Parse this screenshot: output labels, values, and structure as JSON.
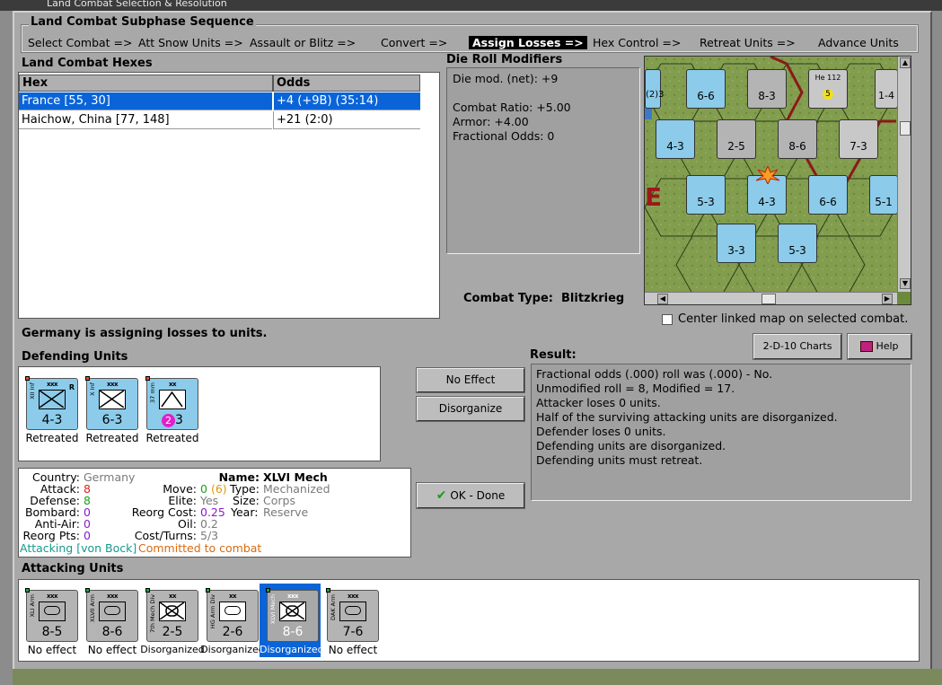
{
  "window": {
    "title": "Land Combat Selection & Resolution"
  },
  "sequence": {
    "title": "Land Combat Subphase Sequence",
    "steps": [
      "Select Combat =>",
      "Att Snow Units =>",
      "Assault or Blitz =>",
      "Convert =>",
      "Assign Losses =>",
      "Hex Control =>",
      "Retreat Units =>",
      "Advance Units"
    ],
    "active": "Assign Losses =>"
  },
  "hexes": {
    "title": "Land Combat Hexes",
    "columns": [
      "Hex",
      "Odds"
    ],
    "rows": [
      {
        "hex": "France [55, 30]",
        "odds": "+4 (+9B) (35:14)"
      },
      {
        "hex": "Haichow, China [77, 148]",
        "odds": "+21 (2:0)"
      }
    ]
  },
  "die_roll": {
    "title": "Die Roll Modifiers",
    "lines": [
      "Die mod. (net): +9",
      "",
      "Combat Ratio: +5.00",
      "Armor: +4.00",
      "Fractional Odds: 0"
    ]
  },
  "combat_type": {
    "label": "Combat Type:",
    "value": "Blitzkrieg"
  },
  "map": {
    "center_linked_label": "Center linked map on selected combat.",
    "unit_labels": [
      "6-6",
      "8-3",
      "He 112",
      "1-4",
      "4-3",
      "2-5",
      "8-6",
      "7-3",
      "5-3",
      "4-3",
      "6-6",
      "5-1",
      "3-3",
      "5-3",
      "(2)3",
      "E",
      "5"
    ]
  },
  "buttons": {
    "charts": "2-D-10 Charts",
    "help": "Help",
    "no_effect": "No Effect",
    "disorganize": "Disorganize",
    "ok_done": "OK - Done"
  },
  "status": "Germany is assigning losses to units.",
  "defending": {
    "title": "Defending Units",
    "units": [
      {
        "side": "XII Inf",
        "size": "xxx",
        "strength": "4-3",
        "status": "Retreated",
        "type": "inf",
        "reserve": "R"
      },
      {
        "side": "X Inf",
        "size": "xxx",
        "strength": "6-3",
        "status": "Retreated",
        "type": "inf",
        "reserve": ""
      },
      {
        "side": "37 mm",
        "size": "xx",
        "strength": "3",
        "badge": "2",
        "status": "Retreated",
        "type": "at",
        "reserve": ""
      }
    ]
  },
  "result": {
    "title": "Result:",
    "lines": [
      "Fractional odds (.000) roll was (.000)  - No.",
      "Unmodified roll = 8, Modified = 17.",
      "Attacker loses 0 units.",
      "Half of the surviving attacking units are disorganized.",
      "Defender loses 0 units.",
      "Defending units are disorganized.",
      "Defending units must retreat."
    ]
  },
  "info": {
    "country_label": "Country:",
    "country": "Germany",
    "name_label": "Name:",
    "name": "XLVI Mech",
    "attack_label": "Attack:",
    "attack": "8",
    "defense_label": "Defense:",
    "defense": "8",
    "bombard_label": "Bombard:",
    "bombard": "0",
    "antiair_label": "Anti-Air:",
    "antiair": "0",
    "reorgpts_label": "Reorg Pts:",
    "reorgpts": "0",
    "move_label": "Move:",
    "move": "0",
    "move_extra": "(6)",
    "type_label": "Type:",
    "type": "Mechanized",
    "elite_label": "Elite:",
    "elite": "Yes",
    "size_label": "Size:",
    "size": "Corps",
    "reorg_cost_label": "Reorg Cost:",
    "reorg_cost": "0.25",
    "year_label": "Year:",
    "year": "Reserve",
    "oil_label": "Oil:",
    "oil": "0.2",
    "cost_label": "Cost/Turns:",
    "cost": "5/3",
    "attacking_note": "Attacking [von Bock]",
    "committed_note": "Committed to combat"
  },
  "attacking": {
    "title": "Attacking Units",
    "units": [
      {
        "side": "XLI Arm",
        "size": "xxx",
        "strength": "8-5",
        "status": "No effect",
        "type": "arm",
        "selected": false
      },
      {
        "side": "XLVII Arm",
        "size": "xxx",
        "strength": "8-6",
        "status": "No effect",
        "type": "arm",
        "selected": false
      },
      {
        "side": "7th Mech Div",
        "size": "xx",
        "strength": "2-5",
        "status": "Disorganized",
        "type": "mech",
        "selected": false
      },
      {
        "side": "HG Arm Div",
        "size": "xx",
        "strength": "2-6",
        "status": "Disorganized",
        "type": "arm",
        "selected": false
      },
      {
        "side": "XLVI Mech",
        "size": "xxx",
        "strength": "8-6",
        "status": "Disorganized",
        "type": "mech",
        "selected": true
      },
      {
        "side": "DAK Arm",
        "size": "xxx",
        "strength": "7-6",
        "status": "No effect",
        "type": "arm",
        "selected": false
      }
    ]
  },
  "colors": {
    "selection": "#0a64d8",
    "attack_red": "#e02020",
    "defense_green": "#18a018",
    "zero_purple": "#8a1ad0",
    "gray_text": "#7a7a7a",
    "attacking_teal": "#169a8a",
    "committed_orange": "#d86a10",
    "unit_blue": "#8ccbea",
    "unit_gray": "#b4b4b4"
  },
  "icons": [
    "checkmark-icon",
    "help-book-icon",
    "scroll-up-icon",
    "scroll-down-icon",
    "scroll-left-icon",
    "scroll-right-icon"
  ]
}
